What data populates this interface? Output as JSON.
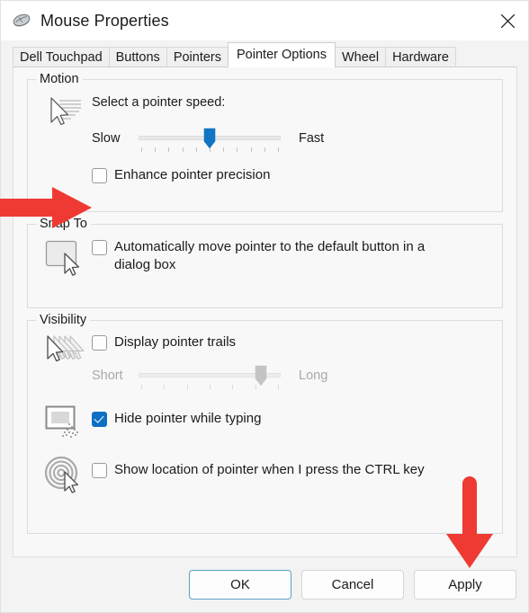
{
  "window": {
    "title": "Mouse Properties",
    "icon": "mouse-icon",
    "close_label": "✕",
    "accent_color": "#0c6fc3",
    "annotation_color": "#ee3a32"
  },
  "tabs": [
    {
      "label": "Dell Touchpad",
      "active": false
    },
    {
      "label": "Buttons",
      "active": false
    },
    {
      "label": "Pointers",
      "active": false
    },
    {
      "label": "Pointer Options",
      "active": true
    },
    {
      "label": "Wheel",
      "active": false
    },
    {
      "label": "Hardware",
      "active": false
    }
  ],
  "groups": {
    "motion": {
      "title": "Motion",
      "icon": "pointer-trail-icon",
      "speed_caption": "Select a pointer speed:",
      "slider": {
        "name": "pointer-speed-slider",
        "min_label": "Slow",
        "max_label": "Fast",
        "value_percent": 50,
        "tick_count": 11,
        "enabled": true
      },
      "enhance_precision": {
        "label": "Enhance pointer precision",
        "checked": false
      }
    },
    "snap_to": {
      "title": "Snap To",
      "icon": "default-button-pointer-icon",
      "auto_move": {
        "label": "Automatically move pointer to the default button in a dialog box",
        "checked": false
      }
    },
    "visibility": {
      "title": "Visibility",
      "trails_icon": "pointer-trails-icon",
      "hide_icon": "hide-pointer-typing-icon",
      "locate_icon": "locate-pointer-icon",
      "display_trails": {
        "label": "Display pointer trails",
        "checked": false
      },
      "trails_slider": {
        "name": "pointer-trails-slider",
        "min_label": "Short",
        "max_label": "Long",
        "value_percent": 86,
        "tick_count": 7,
        "enabled": false
      },
      "hide_while_typing": {
        "label": "Hide pointer while typing",
        "checked": true
      },
      "show_location": {
        "label": "Show location of pointer when I press the CTRL key",
        "checked": false
      }
    }
  },
  "buttons": {
    "ok": "OK",
    "cancel": "Cancel",
    "apply": "Apply"
  },
  "annotations": [
    {
      "name": "arrow-pointing-to-enhance-precision",
      "direction": "right"
    },
    {
      "name": "arrow-pointing-to-apply",
      "direction": "down"
    }
  ]
}
